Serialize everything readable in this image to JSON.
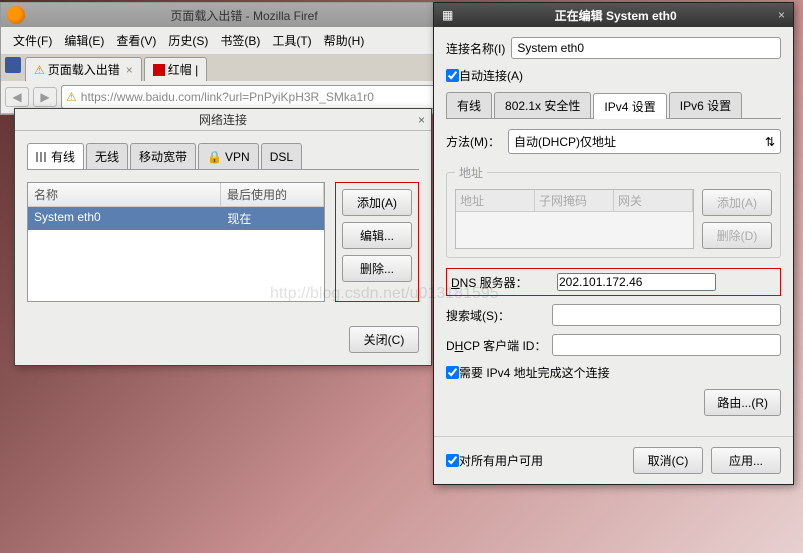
{
  "firefox": {
    "title": "页面载入出错 - Mozilla Firef",
    "menu": [
      "文件(F)",
      "编辑(E)",
      "查看(V)",
      "历史(S)",
      "书签(B)",
      "工具(T)",
      "帮助(H)"
    ],
    "tabs": [
      {
        "label": "页面载入出错"
      },
      {
        "label": "红帽 |"
      }
    ],
    "url": "https://www.baidu.com/link?url=PnPyiKpH3R_SMka1r0"
  },
  "netdlg": {
    "title": "网络连接",
    "tabs": [
      "有线",
      "无线",
      "移动宽带",
      "VPN",
      "DSL"
    ],
    "cols": {
      "name": "名称",
      "last": "最后使用的"
    },
    "row": {
      "name": "System eth0",
      "last": "现在"
    },
    "btns": {
      "add": "添加(A)",
      "edit": "编辑...",
      "del": "删除..."
    },
    "close": "关闭(C)"
  },
  "editdlg": {
    "title": "正在编辑 System eth0",
    "conn_label": "连接名称(I)",
    "conn_value": "System eth0",
    "autoconnect": "自动连接(A)",
    "tabs": [
      "有线",
      "802.1x 安全性",
      "IPv4 设置",
      "IPv6 设置"
    ],
    "method_label": "方法(M)：",
    "method_value": "自动(DHCP)仅地址",
    "addr_legend": "地址",
    "addr_cols": [
      "地址",
      "子网掩码",
      "网关"
    ],
    "addr_btns": {
      "add": "添加(A)",
      "del": "删除(D)"
    },
    "dns_label": "DNS 服务器：",
    "dns_value": "202.101.172.46",
    "search_label": "搜索域(S)：",
    "dhcp_label": "DHCP 客户端 ID：",
    "need_ipv4": "需要 IPv4 地址完成这个连接",
    "routes": "路由...(R)",
    "all_users": "对所有用户可用",
    "cancel": "取消(C)",
    "apply": "应用..."
  },
  "watermark": "http://blog.csdn.net/u013181595"
}
